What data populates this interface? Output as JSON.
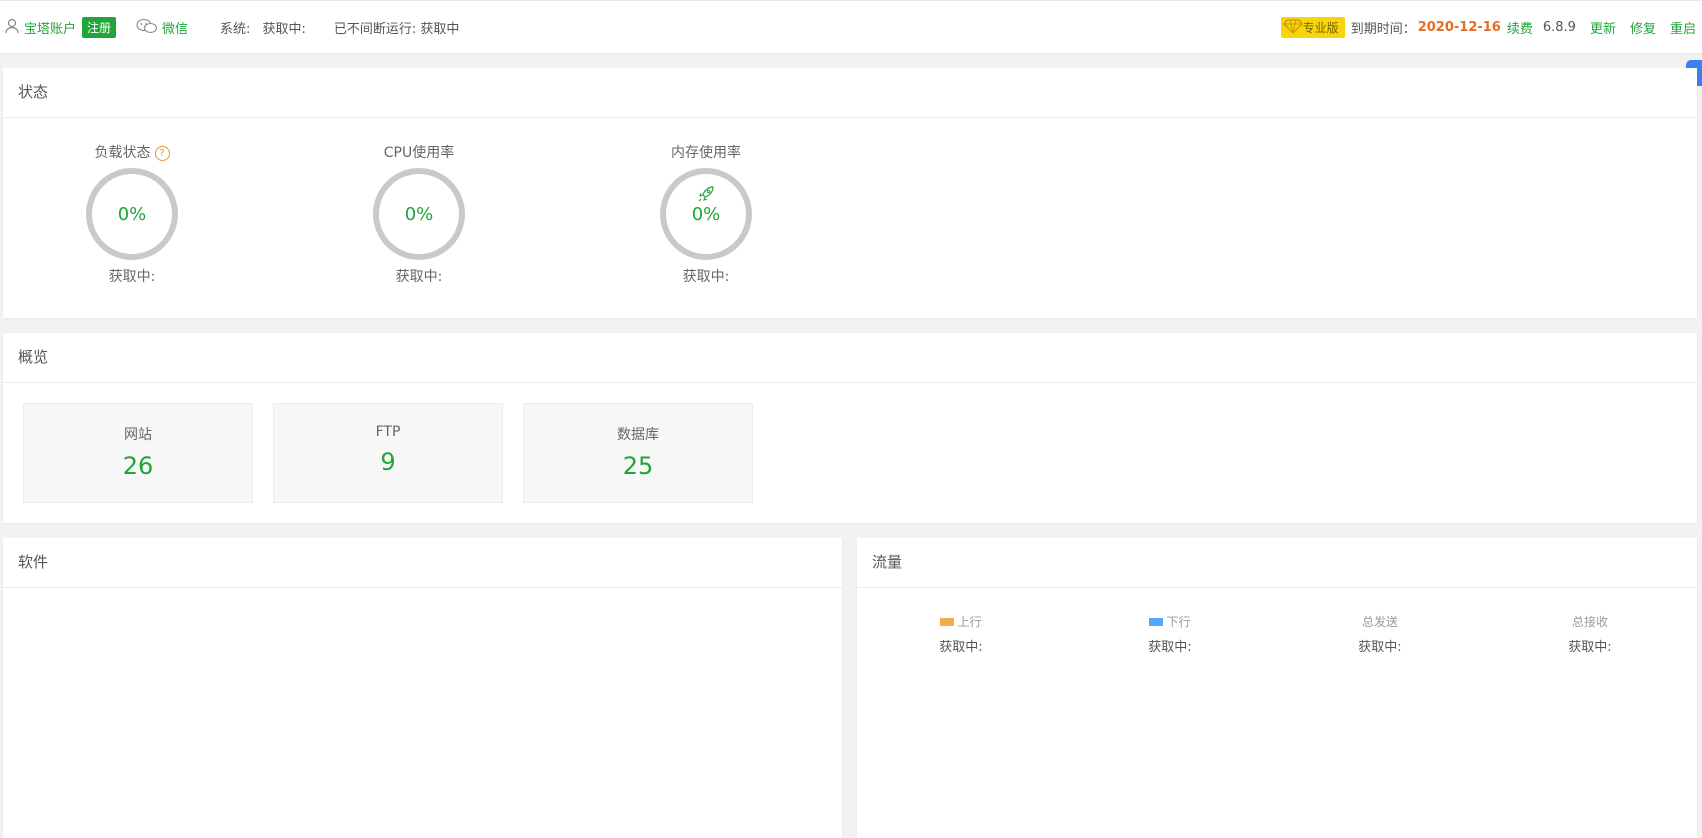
{
  "header": {
    "account_label": "宝塔账户",
    "register_label": "注册",
    "wechat_label": "微信",
    "system_label": "系统:",
    "system_value": "获取中:",
    "uptime_label": "已不间断运行: 获取中",
    "pro_badge": "专业版",
    "expire_label": "到期时间：",
    "expire_date": "2020-12-16",
    "renew_label": "续费",
    "version": "6.8.9",
    "update_label": "更新",
    "repair_label": "修复",
    "restart_label": "重启"
  },
  "status": {
    "title": "状态",
    "gauges": [
      {
        "title": "负载状态",
        "value": "0%",
        "status": "获取中:",
        "icon": "help-icon"
      },
      {
        "title": "CPU使用率",
        "value": "0%",
        "status": "获取中:"
      },
      {
        "title": "内存使用率",
        "value": "0%",
        "status": "获取中:",
        "icon": "rocket-icon"
      }
    ]
  },
  "overview": {
    "title": "概览",
    "cards": [
      {
        "label": "网站",
        "value": "26"
      },
      {
        "label": "FTP",
        "value": "9"
      },
      {
        "label": "数据库",
        "value": "25"
      }
    ]
  },
  "software": {
    "title": "软件"
  },
  "traffic": {
    "title": "流量",
    "columns": [
      {
        "label": "上行",
        "value": "获取中:",
        "color": "#f0ad4e"
      },
      {
        "label": "下行",
        "value": "获取中:",
        "color": "#52a9ff"
      },
      {
        "label": "总发送",
        "value": "获取中:"
      },
      {
        "label": "总接收",
        "value": "获取中:"
      }
    ]
  },
  "colors": {
    "accent": "#20a53a",
    "expire": "#e56d20",
    "pro_badge": "#f7d40b"
  }
}
